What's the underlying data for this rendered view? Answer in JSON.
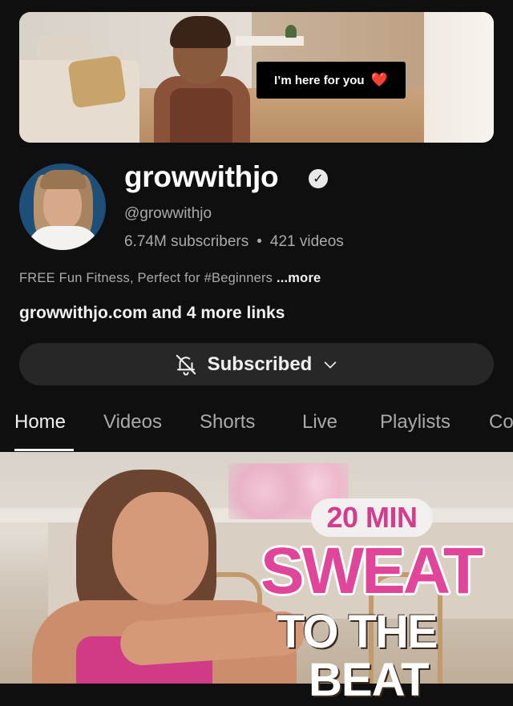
{
  "banner": {
    "caption": "I’m here for you",
    "heart": "❤️"
  },
  "channel": {
    "name": "growwithjo",
    "verified_glyph": "✓",
    "handle": "@growwithjo",
    "subscribers": "6.74M subscribers",
    "separator": "•",
    "videos": "421 videos",
    "description": "FREE Fun Fitness, Perfect for #Beginners",
    "description_more": "...more",
    "link_primary": "growwithjo.com",
    "link_rest": "and 4 more links"
  },
  "subscribe": {
    "label": "Subscribed"
  },
  "tabs": [
    {
      "label": "Home"
    },
    {
      "label": "Videos"
    },
    {
      "label": "Shorts"
    },
    {
      "label": "Live"
    },
    {
      "label": "Playlists"
    },
    {
      "label": "Co"
    }
  ],
  "featured_video": {
    "line1": "20 MIN",
    "line2": "SWEAT",
    "line3": "TO THE",
    "line4": "BEAT"
  },
  "colors": {
    "background": "#0f0f0f",
    "button": "#272727",
    "secondary_text": "#aaaaaa",
    "accent_pink": "#e0459a"
  },
  "icons": {
    "verified": "verified-check-icon",
    "bell": "bell-off-icon",
    "chevron": "chevron-down-icon"
  }
}
